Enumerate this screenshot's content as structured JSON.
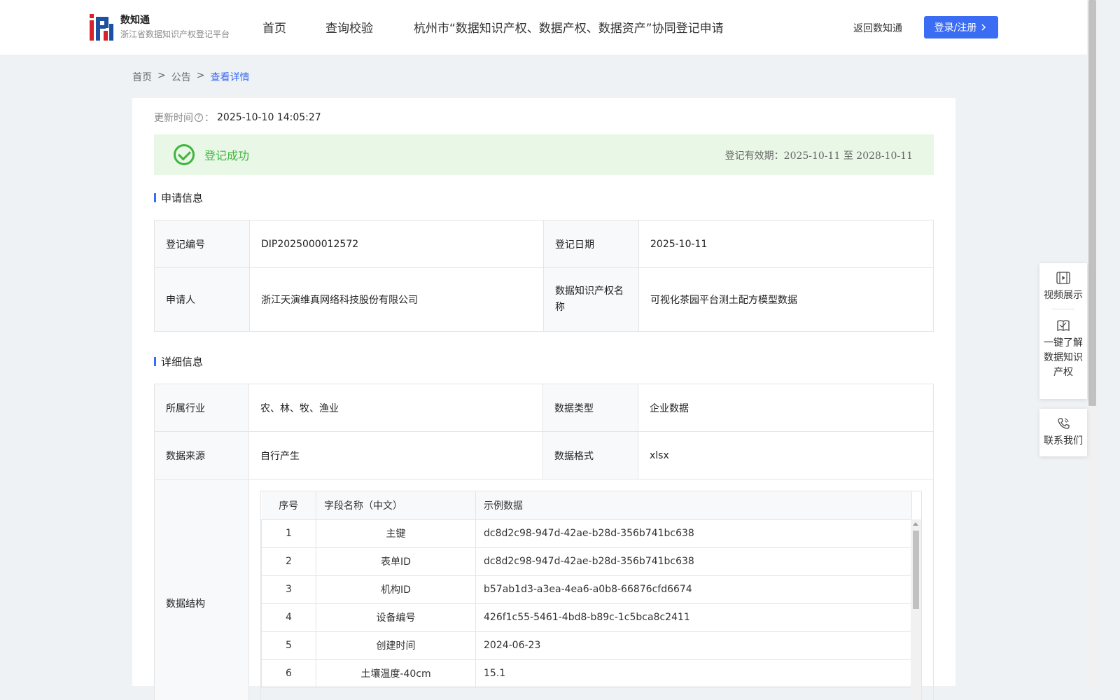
{
  "header": {
    "logo_title": "数知通",
    "logo_subtitle": "浙江省数据知识产权登记平台",
    "nav": [
      "首页",
      "查询校验",
      "杭州市“数据知识产权、数据产权、数据资产”协同登记申请"
    ],
    "return_label": "返回数知通",
    "login_label": "登录/注册"
  },
  "breadcrumb": [
    "首页",
    "公告",
    "查看详情"
  ],
  "update": {
    "label": "更新时间",
    "colon": "：",
    "value": "2025-10-10 14:05:27"
  },
  "status": {
    "text": "登记成功",
    "validity_label": "登记有效期：",
    "validity_from": "2025-10-11",
    "validity_sep": "至",
    "validity_to": "2028-10-11",
    "color": "#40b53f"
  },
  "apply_section": {
    "title": "申请信息",
    "reg_no_label": "登记编号",
    "reg_no": "DIP2025000012572",
    "reg_date_label": "登记日期",
    "reg_date": "2025-10-11",
    "applicant_label": "申请人",
    "applicant": "浙江天演维真网络科技股份有限公司",
    "ip_name_label": "数据知识产权名称",
    "ip_name": "可视化茶园平台测土配方模型数据"
  },
  "detail_section": {
    "title": "详细信息",
    "industry_label": "所属行业",
    "industry": "农、林、牧、渔业",
    "data_type_label": "数据类型",
    "data_type": "企业数据",
    "source_label": "数据来源",
    "source": "自行产生",
    "format_label": "数据格式",
    "format": "xlsx",
    "structure_label": "数据结构",
    "columns": [
      "序号",
      "字段名称（中文）",
      "示例数据"
    ],
    "rows": [
      {
        "no": "1",
        "name": "主键",
        "sample": "dc8d2c98-947d-42ae-b28d-356b741bc638"
      },
      {
        "no": "2",
        "name": "表单ID",
        "sample": "dc8d2c98-947d-42ae-b28d-356b741bc638"
      },
      {
        "no": "3",
        "name": "机构ID",
        "sample": "b57ab1d3-a3ea-4ea6-a0b8-66876cfd6674"
      },
      {
        "no": "4",
        "name": "设备编号",
        "sample": "426f1c55-5461-4bd8-b89c-1c5bca8c2411"
      },
      {
        "no": "5",
        "name": "创建时间",
        "sample": "2024-06-23"
      },
      {
        "no": "6",
        "name": "土壤温度-40cm",
        "sample": "15.1"
      }
    ]
  },
  "float_panel": {
    "video": "视频展示",
    "learn": [
      "一键了解",
      "数据知识",
      "产权"
    ],
    "contact": "联系我们"
  },
  "colors": {
    "accent": "#3a6cf4",
    "success_bg": "#e9f7e6"
  }
}
